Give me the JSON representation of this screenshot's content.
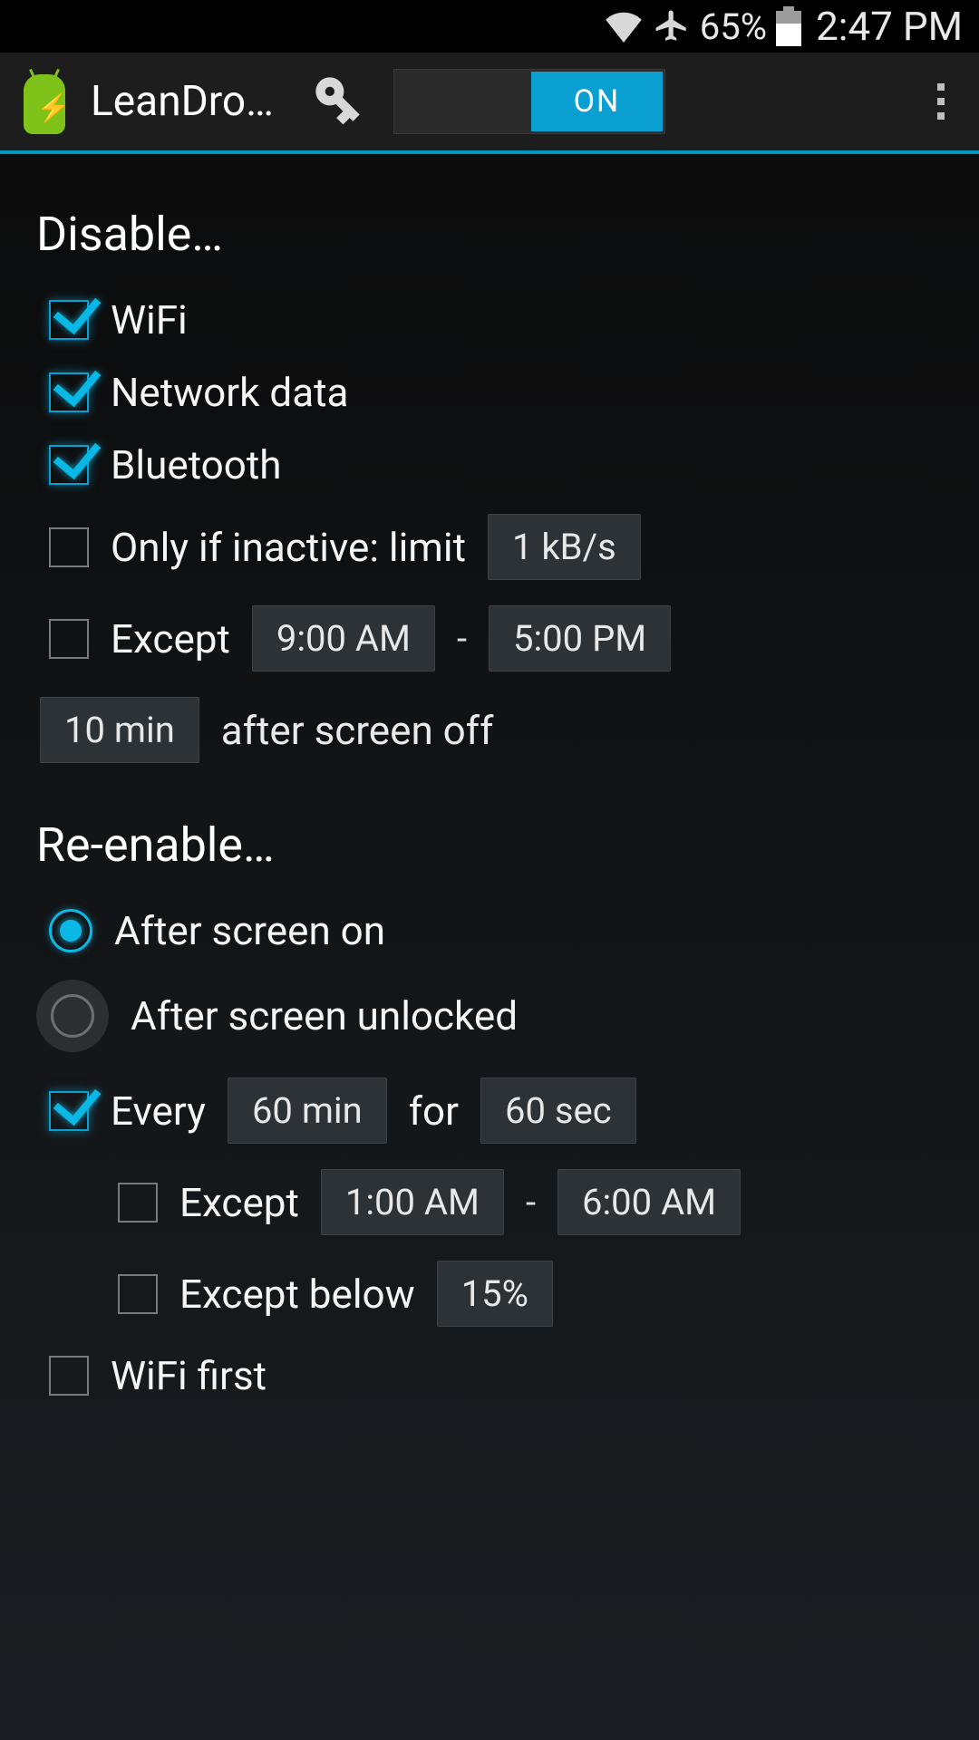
{
  "status": {
    "battery_pct": "65%",
    "clock": "2:47 PM"
  },
  "header": {
    "title": "LeanDro…",
    "toggle_label": "ON"
  },
  "disable": {
    "title": "Disable…",
    "wifi": "WiFi",
    "network_data": "Network data",
    "bluetooth": "Bluetooth",
    "only_if_inactive": "Only if inactive: limit",
    "inactive_limit": "1 kB/s",
    "except": "Except",
    "except_from": "9:00 AM",
    "except_to": "5:00 PM",
    "after_delay": "10 min",
    "after_label": "after screen off"
  },
  "reenable": {
    "title": "Re-enable…",
    "after_screen_on": "After screen on",
    "after_unlocked": "After screen unlocked",
    "every": "Every",
    "every_interval": "60 min",
    "for": "for",
    "every_duration": "60 sec",
    "except": "Except",
    "except_from": "1:00 AM",
    "except_to": "6:00 AM",
    "except_below": "Except below",
    "except_below_val": "15%",
    "wifi_first": "WiFi first"
  }
}
